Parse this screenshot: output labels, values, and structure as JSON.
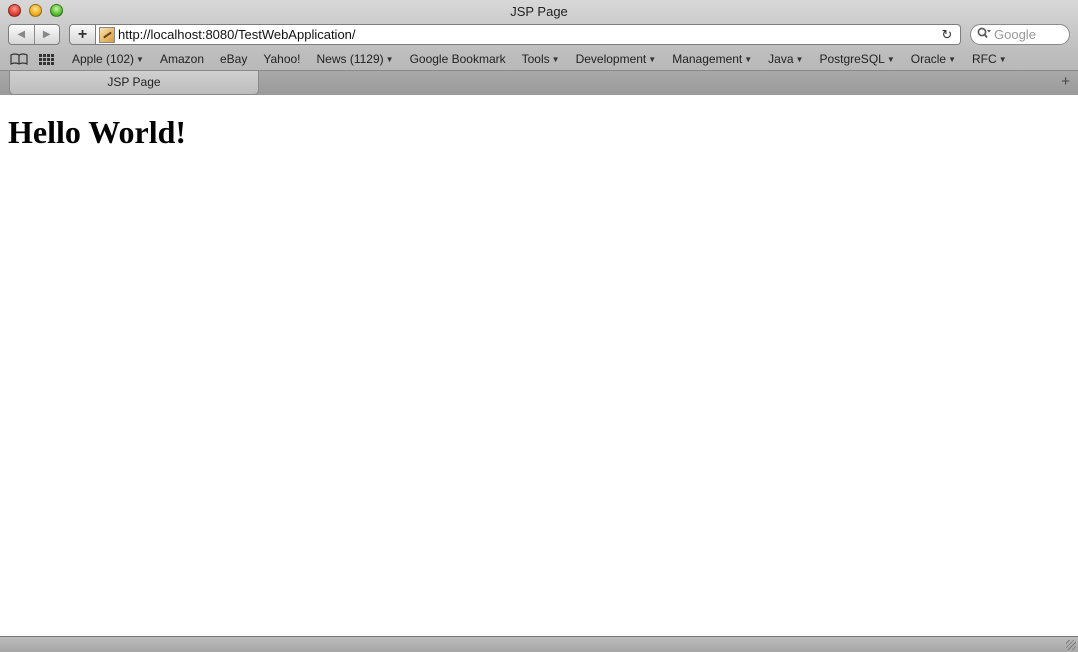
{
  "window": {
    "title": "JSP Page"
  },
  "toolbar": {
    "back_icon": "back-arrow-icon",
    "forward_icon": "forward-arrow-icon",
    "add_label": "+",
    "url": "http://localhost:8080/TestWebApplication/",
    "search_placeholder": "Google"
  },
  "bookmarks": {
    "items": [
      {
        "label": "Apple (102)",
        "menu": true
      },
      {
        "label": "Amazon",
        "menu": false
      },
      {
        "label": "eBay",
        "menu": false
      },
      {
        "label": "Yahoo!",
        "menu": false
      },
      {
        "label": "News (1129)",
        "menu": true
      },
      {
        "label": "Google Bookmark",
        "menu": false
      },
      {
        "label": "Tools",
        "menu": true
      },
      {
        "label": "Development",
        "menu": true
      },
      {
        "label": "Management",
        "menu": true
      },
      {
        "label": "Java",
        "menu": true
      },
      {
        "label": "PostgreSQL",
        "menu": true
      },
      {
        "label": "Oracle",
        "menu": true
      },
      {
        "label": "RFC",
        "menu": true
      }
    ]
  },
  "tabs": [
    {
      "label": "JSP Page"
    }
  ],
  "page": {
    "heading": "Hello World!"
  }
}
